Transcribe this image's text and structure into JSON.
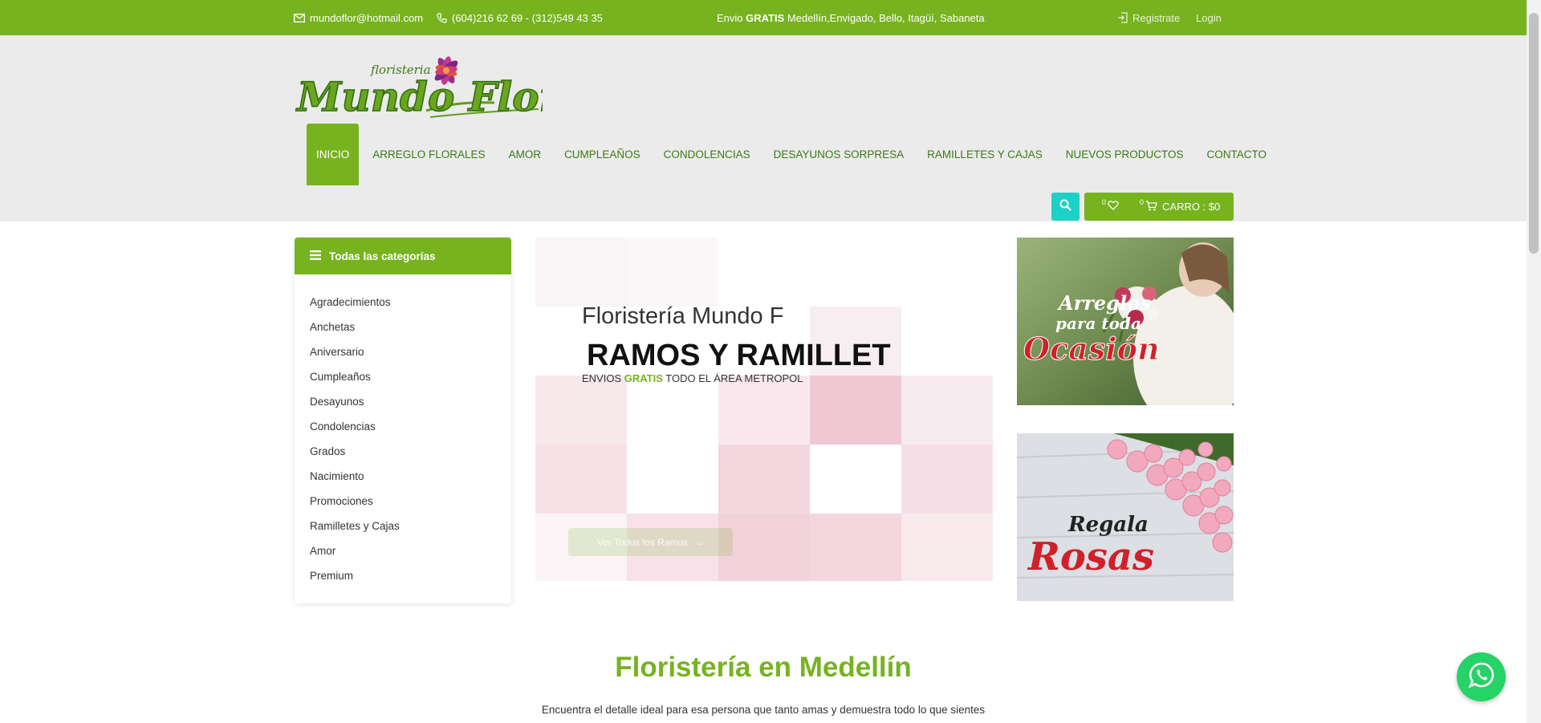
{
  "topbar": {
    "email": "mundoflor@hotmail.com",
    "phones": "(604)216 62 69 - (312)549 43 35",
    "shipping_prefix": "Envio ",
    "shipping_bold": "GRATIS",
    "shipping_suffix": " Medellín,Envigado, Bello, Itagüí, Sabaneta",
    "register": "Registrate",
    "login": "Login"
  },
  "logo": {
    "small": "floristeria",
    "main": "Mundo Flor"
  },
  "nav": {
    "items": [
      "INICIO",
      "ARREGLO FLORALES",
      "AMOR",
      "CUMPLEAÑOS",
      "CONDOLENCIAS",
      "DESAYUNOS SORPRESA",
      "RAMILLETES Y CAJAS",
      "NUEVOS PRODUCTOS",
      "CONTACTO"
    ]
  },
  "cart": {
    "wishlist_count": "0",
    "cart_count": "0",
    "label": "CARRO : $0"
  },
  "sidebar": {
    "title": "Todas las categorías",
    "categories": [
      "Agradecimientos",
      "Anchetas",
      "Aniversario",
      "Cumpleaños",
      "Desayunos",
      "Condolencias",
      "Grados",
      "Nacimiento",
      "Promociones",
      "Ramilletes y Cajas",
      "Amor",
      "Premium"
    ]
  },
  "slider": {
    "title": "Floristería Mundo F",
    "subtitle": "RAMOS Y RAMILLET",
    "tag_prefix": "ENVIOS ",
    "tag_bold": "GRATIS",
    "tag_suffix": " TODO EL ÁREA METROPOL",
    "button": "Ver Todos los Ramos"
  },
  "banners": {
    "one_line1": "Arreglos",
    "one_line2": "para toda",
    "one_line3": "Ocasión",
    "two_line1": "Regala",
    "two_line2": "Rosas"
  },
  "section": {
    "title": "Floristería en Medellín",
    "subtitle": "Encuentra el detalle ideal para esa persona que tanto amas y demuestra todo lo que sientes"
  },
  "colors": {
    "brand_green": "#76b31f",
    "nav_text": "#3b7a15",
    "search_teal": "#1ed1c6",
    "whatsapp": "#25d366",
    "banner_red": "#d0202a"
  },
  "icons": [
    "envelope-icon",
    "phone-icon",
    "login-icon",
    "menu-icon",
    "search-icon",
    "heart-icon",
    "cart-icon",
    "arrow-right-icon",
    "whatsapp-icon"
  ]
}
